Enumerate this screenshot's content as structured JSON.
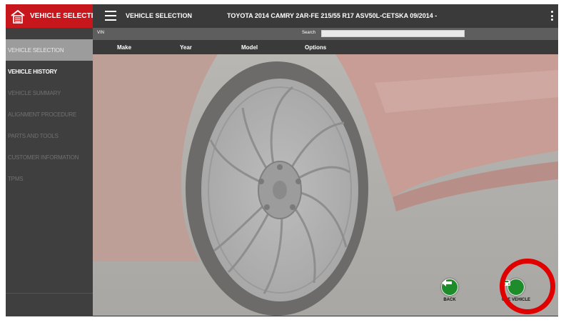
{
  "brand": {
    "label": "VEHICLE SELECTION"
  },
  "header": {
    "title": "VEHICLE SELECTION",
    "vehicle": "TOYOTA 2014 CAMRY 2AR-FE 215/55 R17 ASV50L-CETSKA 09/2014 -"
  },
  "nav": {
    "items": [
      {
        "label": "VEHICLE SELECTION",
        "state": "active"
      },
      {
        "label": "VEHICLE HISTORY",
        "state": "enabled"
      },
      {
        "label": "VEHICLE SUMMARY",
        "state": "disabled"
      },
      {
        "label": "ALIGNMENT PROCEDURE",
        "state": "disabled"
      },
      {
        "label": "PARTS AND TOOLS",
        "state": "disabled"
      },
      {
        "label": "CUSTOMER INFORMATION",
        "state": "disabled"
      },
      {
        "label": "TPMS",
        "state": "disabled"
      }
    ]
  },
  "vinbar": {
    "vin_label": "VIN",
    "search_label": "Search",
    "search_value": ""
  },
  "columns": [
    "Make",
    "Year",
    "Model",
    "Options"
  ],
  "actions": {
    "back_label": "BACK",
    "use_vehicle_label": "USE VEHICLE"
  },
  "colors": {
    "brand": "#c8161d",
    "action": "#1f8c2c",
    "highlight": "#e10000"
  },
  "icons": {
    "brand": "garage-home-icon",
    "menu": "hamburger-menu-icon",
    "more": "kebab-menu-icon",
    "back": "arrow-left-icon",
    "use_vehicle": "car-icon"
  }
}
